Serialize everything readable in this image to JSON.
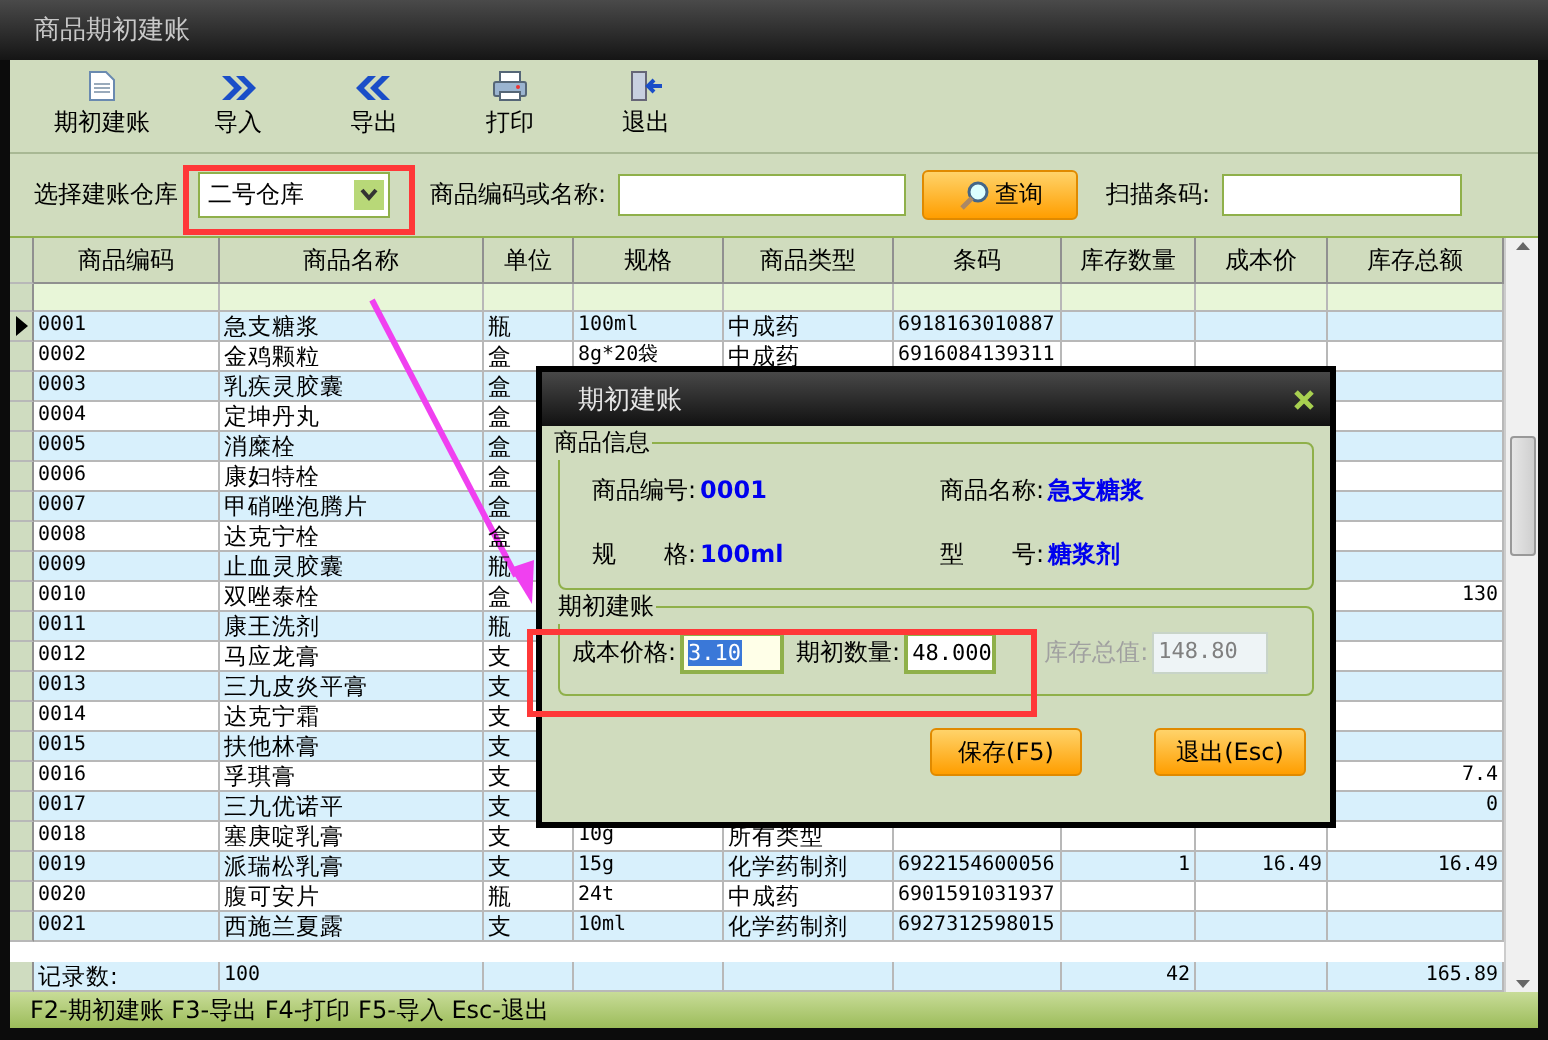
{
  "window": {
    "title": "商品期初建账"
  },
  "toolbar": [
    {
      "kind": "new",
      "label": "期初建账"
    },
    {
      "kind": "import",
      "label": "导入"
    },
    {
      "kind": "export",
      "label": "导出"
    },
    {
      "kind": "print",
      "label": "打印"
    },
    {
      "kind": "exit",
      "label": "退出"
    }
  ],
  "filter": {
    "warehouse_label": "选择建账仓库",
    "warehouse_value": "二号仓库",
    "search_label": "商品编码或名称:",
    "search_button": "查询",
    "barcode_label": "扫描条码:"
  },
  "table": {
    "columns": [
      "商品编码",
      "商品名称",
      "单位",
      "规格",
      "商品类型",
      "条码",
      "库存数量",
      "成本价",
      "库存总额"
    ],
    "rows": [
      {
        "selected": true,
        "code": "0001",
        "name": "急支糖浆",
        "unit": "瓶",
        "spec": "100ml",
        "type": "中成药",
        "barcode": "6918163010887"
      },
      {
        "selected": false,
        "code": "0002",
        "name": "金鸡颗粒",
        "unit": "盒",
        "spec": "8g*20袋",
        "type": "中成药",
        "barcode": "6916084139311"
      },
      {
        "selected": false,
        "code": "0003",
        "name": "乳疾灵胶囊",
        "unit": "盒"
      },
      {
        "selected": false,
        "code": "0004",
        "name": "定坤丹丸",
        "unit": "盒"
      },
      {
        "selected": false,
        "code": "0005",
        "name": "消糜栓",
        "unit": "盒"
      },
      {
        "selected": false,
        "code": "0006",
        "name": "康妇特栓",
        "unit": "盒"
      },
      {
        "selected": false,
        "code": "0007",
        "name": "甲硝唑泡腾片",
        "unit": "盒"
      },
      {
        "selected": false,
        "code": "0008",
        "name": "达克宁栓",
        "unit": "盒"
      },
      {
        "selected": false,
        "code": "0009",
        "name": "止血灵胶囊",
        "unit": "瓶"
      },
      {
        "selected": false,
        "code": "0010",
        "name": "双唑泰栓",
        "unit": "盒",
        "total": "130"
      },
      {
        "selected": false,
        "code": "0011",
        "name": "康王洗剂",
        "unit": "瓶"
      },
      {
        "selected": false,
        "code": "0012",
        "name": "马应龙膏",
        "unit": "支"
      },
      {
        "selected": false,
        "code": "0013",
        "name": "三九皮炎平膏",
        "unit": "支"
      },
      {
        "selected": false,
        "code": "0014",
        "name": "达克宁霜",
        "unit": "支"
      },
      {
        "selected": false,
        "code": "0015",
        "name": "扶他林膏",
        "unit": "支"
      },
      {
        "selected": false,
        "code": "0016",
        "name": "孚琪膏",
        "unit": "支",
        "total": "7.4"
      },
      {
        "selected": false,
        "code": "0017",
        "name": "三九优诺平",
        "unit": "支",
        "total": "0"
      },
      {
        "selected": false,
        "code": "0018",
        "name": "塞庚啶乳膏",
        "unit": "支",
        "spec": "10g",
        "type": "所有类型"
      },
      {
        "selected": false,
        "code": "0019",
        "name": "派瑞松乳膏",
        "unit": "支",
        "spec": "15g",
        "type": "化学药制剂",
        "barcode": "6922154600056",
        "qty": "1",
        "cost": "16.49",
        "total": "16.49"
      },
      {
        "selected": false,
        "code": "0020",
        "name": "腹可安片",
        "unit": "瓶",
        "spec": "24t",
        "type": "中成药",
        "barcode": "6901591031937"
      },
      {
        "selected": false,
        "code": "0021",
        "name": "西施兰夏露",
        "unit": "支",
        "spec": "10ml",
        "type": "化学药制剂",
        "barcode": "6927312598015"
      }
    ],
    "footer": {
      "code": "记录数:",
      "name": "100",
      "qty": "42",
      "total": "165.89"
    }
  },
  "status_bar": "F2-期初建账 F3-导出 F4-打印 F5-导入 Esc-退出",
  "dialog": {
    "title": "期初建账",
    "info_title": "商品信息",
    "info": [
      {
        "label": "商品编号:",
        "value": "0001"
      },
      {
        "label": "商品名称:",
        "value": "急支糖浆"
      },
      {
        "label": "规　　格:",
        "value": "100ml"
      },
      {
        "label": "型　　号:",
        "value": "糖浆剂"
      }
    ],
    "entry_title": "期初建账",
    "fields": [
      {
        "label": "成本价格:",
        "value": "3.10",
        "disabled": false,
        "text_selected": true
      },
      {
        "label": "期初数量:",
        "value": "48.000",
        "disabled": false,
        "text_selected": false
      },
      {
        "label": "库存总值:",
        "value": "148.80",
        "disabled": true,
        "text_selected": false
      }
    ],
    "buttons": [
      "保存(F5)",
      "退出(Esc)"
    ]
  }
}
